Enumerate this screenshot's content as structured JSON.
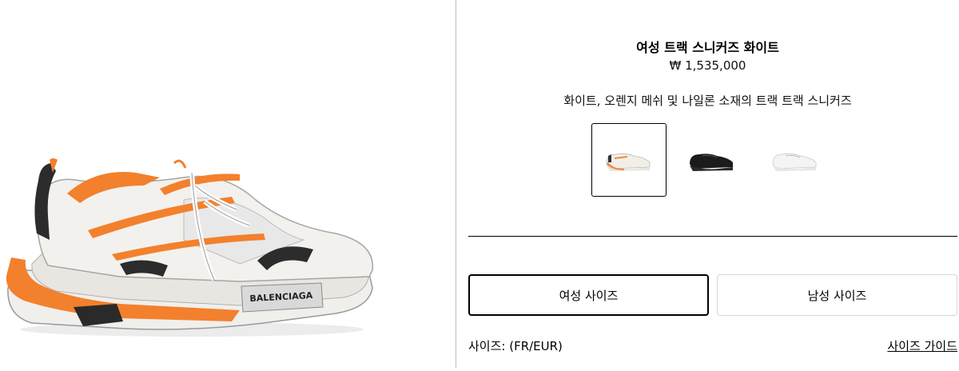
{
  "product": {
    "title": "여성 트랙 스니커즈 화이트",
    "price": "₩ 1,535,000",
    "description": "화이트, 오렌지 메쉬 및 나일론 소재의 트랙 트랙 스니커즈",
    "brand_print": "BALENCIAGA"
  },
  "swatches": [
    {
      "name": "white-orange",
      "selected": true,
      "color": "#f2efe9",
      "accent": "#f08a3c"
    },
    {
      "name": "black",
      "selected": false,
      "color": "#1b1b1b",
      "accent": "#3a3a3a"
    },
    {
      "name": "white",
      "selected": false,
      "color": "#f4f4f4",
      "accent": "#d9d9d9"
    }
  ],
  "size": {
    "women_label": "여성 사이즈",
    "men_label": "남성 사이즈",
    "size_label": "사이즈: (FR/EUR)",
    "guide_label": "사이즈 가이드"
  },
  "colors": {
    "orange": "#f3802d",
    "divider": "#bdbdbd"
  }
}
